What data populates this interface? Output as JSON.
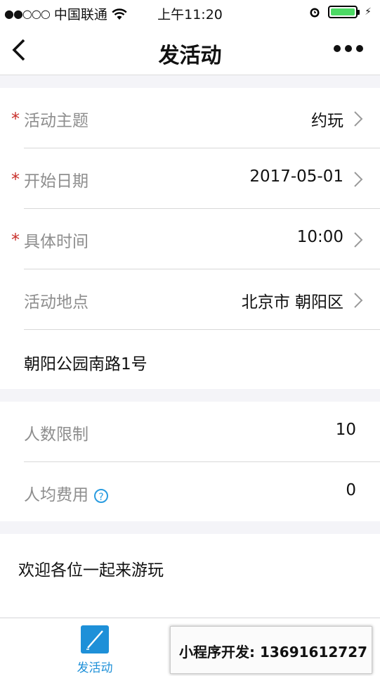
{
  "status_bar": {
    "carrier": "中国联通",
    "time": "上午11:20"
  },
  "navbar": {
    "title": "发活动"
  },
  "form": {
    "theme": {
      "label": "活动主题",
      "value": "约玩",
      "required": true
    },
    "start_date": {
      "label": "开始日期",
      "value": "2017-05-01",
      "required": true
    },
    "time": {
      "label": "具体时间",
      "value": "10:00",
      "required": true
    },
    "location": {
      "label": "活动地点",
      "value": "北京市 朝阳区",
      "required": false
    },
    "address": {
      "value": "朝阳公园南路1号"
    },
    "people_limit": {
      "label": "人数限制",
      "value": "10"
    },
    "fee_per_person": {
      "label": "人均费用",
      "value": "0",
      "help_icon": "?"
    },
    "description": {
      "value": "欢迎各位一起来游玩"
    }
  },
  "tabbar": {
    "tabs": [
      {
        "label": "发活动",
        "icon": "edit-icon",
        "active": true
      }
    ]
  },
  "promo": {
    "text": "小程序开发: 13691612727"
  },
  "colors": {
    "required_star": "#c8302b",
    "accent": "#1e90d8",
    "battery": "#4cd964"
  }
}
